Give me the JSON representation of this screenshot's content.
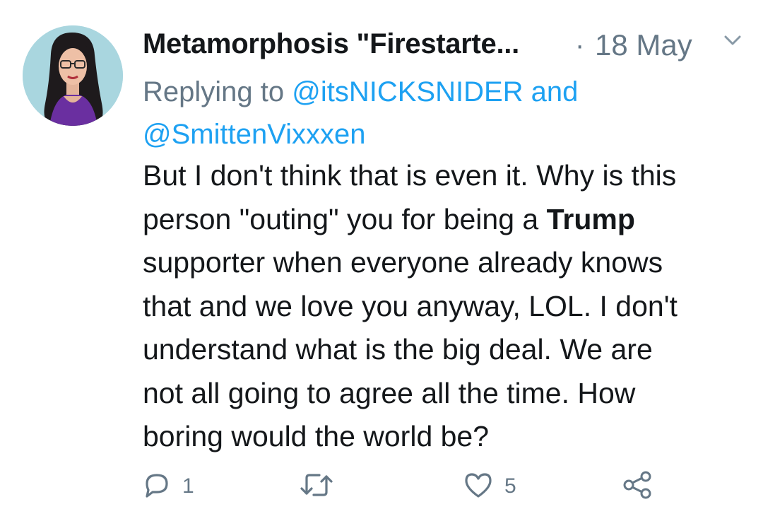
{
  "tweet": {
    "display_name": "Metamorphosis \"Firestarte...",
    "separator": "·",
    "date": "18 May",
    "reply_prefix": "Replying to ",
    "reply_to_1": "@itsNICKSNIDER",
    "reply_and": " and",
    "reply_to_2": "@SmittenVixxxen",
    "body_line1": "But I don't think that is even it. Why is this",
    "body_line2_a": "person \"outing\" you for being a ",
    "body_line2_bold": "Trump",
    "body_line3": "supporter when everyone already knows",
    "body_line4": "that and we love you anyway, LOL.  I don't",
    "body_line5": "understand what is the big deal. We are",
    "body_line6": "not all going to agree all the time. How",
    "body_line7": "boring would the world be?"
  },
  "actions": {
    "reply_count": "1",
    "retweet_count": "",
    "like_count": "5"
  },
  "icons": {
    "reply": "reply-icon",
    "retweet": "retweet-icon",
    "like": "heart-icon",
    "share": "share-icon",
    "caret": "chevron-down-icon"
  },
  "colors": {
    "text": "#14171a",
    "secondary": "#657786",
    "link": "#1da1f2",
    "avatar_bg": "#a9d6df"
  }
}
